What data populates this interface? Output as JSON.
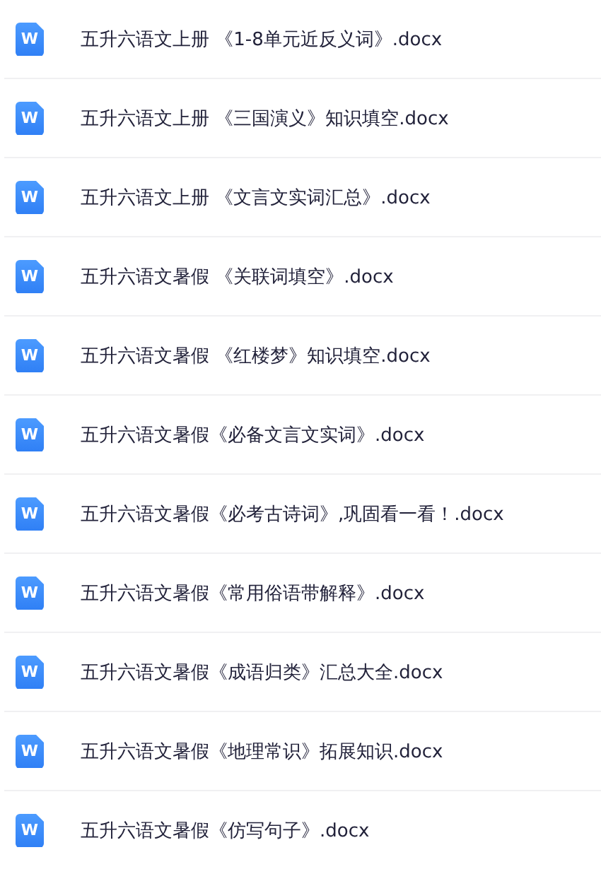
{
  "files": [
    {
      "name": "五升六语文上册 《1-8单元近反义词》.docx",
      "icon_label": "W"
    },
    {
      "name": "五升六语文上册 《三国演义》知识填空.docx",
      "icon_label": "W"
    },
    {
      "name": "五升六语文上册 《文言文实词汇总》.docx",
      "icon_label": "W"
    },
    {
      "name": "五升六语文暑假 《关联词填空》.docx",
      "icon_label": "W"
    },
    {
      "name": "五升六语文暑假 《红楼梦》知识填空.docx",
      "icon_label": "W"
    },
    {
      "name": "五升六语文暑假《必备文言文实词》.docx",
      "icon_label": "W"
    },
    {
      "name": "五升六语文暑假《必考古诗词》,巩固看一看！.docx",
      "icon_label": "W"
    },
    {
      "name": "五升六语文暑假《常用俗语带解释》.docx",
      "icon_label": "W"
    },
    {
      "name": "五升六语文暑假《成语归类》汇总大全.docx",
      "icon_label": "W"
    },
    {
      "name": "五升六语文暑假《地理常识》拓展知识.docx",
      "icon_label": "W"
    },
    {
      "name": "五升六语文暑假《仿写句子》.docx",
      "icon_label": "W"
    }
  ]
}
